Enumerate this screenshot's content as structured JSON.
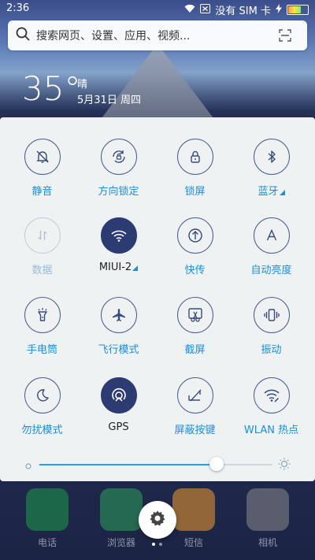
{
  "status_bar": {
    "time": "2:36",
    "sim_text": "没有 SIM 卡",
    "icons": [
      "wifi-icon",
      "no-sim-icon",
      "charging-icon",
      "battery-icon"
    ]
  },
  "search": {
    "placeholder": "搜索网页、设置、应用、视频..."
  },
  "weather": {
    "temperature": "35°",
    "condition": "晴",
    "date": "5月31日 周四"
  },
  "toggles": [
    {
      "label": "静音",
      "icon": "silent-bell-icon",
      "state": "off"
    },
    {
      "label": "方向锁定",
      "icon": "rotation-lock-icon",
      "state": "off"
    },
    {
      "label": "锁屏",
      "icon": "lock-icon",
      "state": "off"
    },
    {
      "label": "蓝牙",
      "icon": "bluetooth-icon",
      "state": "off",
      "has_menu": true
    },
    {
      "label": "数据",
      "icon": "mobile-data-icon",
      "state": "disabled"
    },
    {
      "label": "MIUI-2",
      "icon": "wifi-icon",
      "state": "on",
      "has_menu": true
    },
    {
      "label": "快传",
      "icon": "quick-transfer-icon",
      "state": "off"
    },
    {
      "label": "自动亮度",
      "icon": "auto-brightness-icon",
      "state": "off"
    },
    {
      "label": "手电筒",
      "icon": "flashlight-icon",
      "state": "off"
    },
    {
      "label": "飞行模式",
      "icon": "airplane-icon",
      "state": "off"
    },
    {
      "label": "截屏",
      "icon": "screenshot-icon",
      "state": "off"
    },
    {
      "label": "振动",
      "icon": "vibrate-icon",
      "state": "off"
    },
    {
      "label": "勿扰模式",
      "icon": "do-not-disturb-icon",
      "state": "off"
    },
    {
      "label": "GPS",
      "icon": "gps-icon",
      "state": "on"
    },
    {
      "label": "屏蔽按键",
      "icon": "block-keys-icon",
      "state": "off"
    },
    {
      "label": "WLAN 热点",
      "icon": "hotspot-icon",
      "state": "off"
    }
  ],
  "brightness": {
    "level_fraction": 0.76
  },
  "dock": {
    "apps": [
      {
        "label": "电话",
        "icon": "phone-icon",
        "color": "#1e9d48"
      },
      {
        "label": "浏览器",
        "icon": "browser-icon",
        "color": "#2ca05a"
      },
      {
        "label": "短信",
        "icon": "message-icon",
        "color": "#f39a2c"
      },
      {
        "label": "相机",
        "icon": "camera-icon",
        "color": "#8a8a8a"
      }
    ]
  },
  "colors": {
    "accent": "#1c8fd6",
    "active_circle": "#2c3c73",
    "panel_bg": "#eef2f3"
  }
}
